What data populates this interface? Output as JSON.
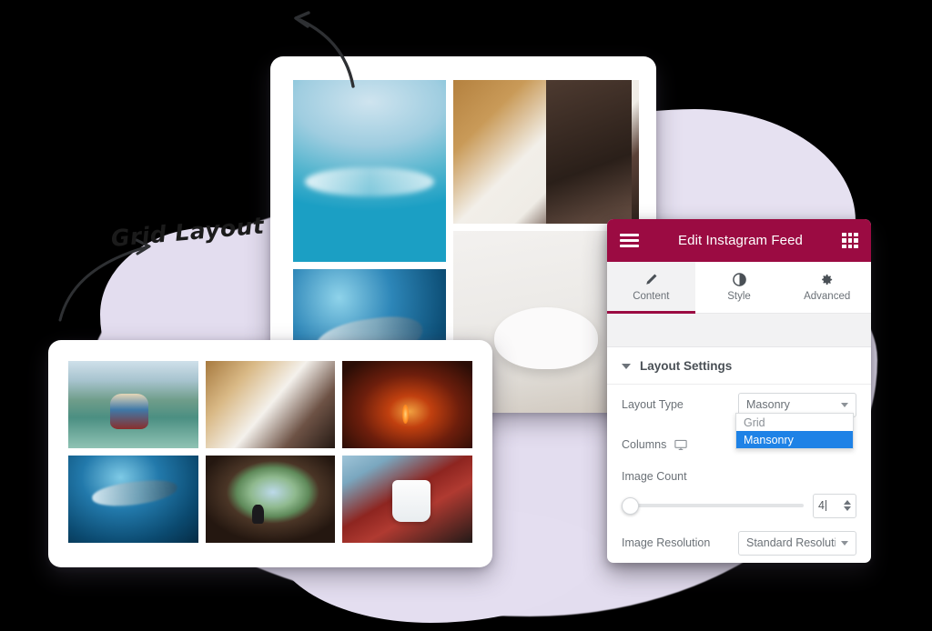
{
  "annotations": {
    "grid_layout_label": "Grid Layout",
    "arrow_top_name": "curved-arrow-up-left",
    "arrow_left_name": "curved-arrow-to-label"
  },
  "panel": {
    "header": {
      "title": "Edit Instagram Feed",
      "menu_icon": "hamburger-icon",
      "grid_icon": "grid-icon",
      "bg_color": "#9B0B42"
    },
    "tabs": [
      {
        "label": "Content",
        "icon": "pencil-icon",
        "active": true
      },
      {
        "label": "Style",
        "icon": "contrast-icon",
        "active": false
      },
      {
        "label": "Advanced",
        "icon": "gear-icon",
        "active": false
      }
    ],
    "section": {
      "title": "Layout Settings",
      "caret_icon": "caret-down-icon",
      "expanded": true
    },
    "fields": {
      "layout_type": {
        "label": "Layout Type",
        "value": "Masonry",
        "open": true,
        "options": [
          {
            "label": "Grid",
            "selected": false
          },
          {
            "label": "Mansonry",
            "selected": true
          }
        ],
        "highlight_color": "#1E82E6"
      },
      "columns": {
        "label": "Columns",
        "device_icon": "monitor-icon"
      },
      "image_count": {
        "label": "Image Count",
        "value": "4",
        "slider_percent": 0
      },
      "image_resolution": {
        "label": "Image Resolution",
        "value": "Standard Resolutio"
      }
    }
  },
  "masonry_card": {
    "name": "masonry-layout-preview",
    "photos": [
      {
        "alt": "surfers-riding-big-wave",
        "art": "img-wave"
      },
      {
        "alt": "woman-painting-ceramic-mug",
        "art": "img-paint"
      },
      {
        "alt": "dolphins-underwater",
        "art": "img-dolphin"
      },
      {
        "alt": "side-table-with-candle",
        "art": "img-table"
      }
    ]
  },
  "grid_card": {
    "name": "grid-layout-preview",
    "photos": [
      {
        "alt": "woman-canoeing-mountain-lake",
        "art": "img-canoe"
      },
      {
        "alt": "woman-painting-pottery",
        "art": "img-paint2"
      },
      {
        "alt": "lit-cave-tunnel",
        "art": "img-cave"
      },
      {
        "alt": "dolphins-swimming",
        "art": "img-dolphin2"
      },
      {
        "alt": "hiker-in-cave-opening",
        "art": "img-hiker"
      },
      {
        "alt": "hands-holding-adventure-mug",
        "art": "img-mug"
      }
    ]
  },
  "colors": {
    "brand_maroon": "#9B0B42",
    "blob_purple": "#E3DDEF",
    "dropdown_blue": "#1E82E6",
    "canvas_black": "#000000"
  }
}
